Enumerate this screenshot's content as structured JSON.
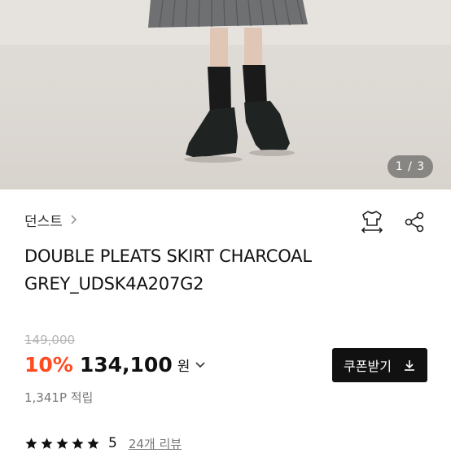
{
  "gallery": {
    "counter": "1 / 3"
  },
  "brand": {
    "name": "던스트"
  },
  "product": {
    "title_line1": "DOUBLE PLEATS SKIRT CHARCOAL",
    "title_line2": "GREY_UDSK4A207G2",
    "original_price": "149,000",
    "discount": "10%",
    "price": "134,100",
    "currency": "원",
    "points": "1,341P 적립"
  },
  "coupon": {
    "label": "쿠폰받기"
  },
  "rating": {
    "stars": 5,
    "score": "5",
    "reviews": "24개 리뷰"
  },
  "colors": {
    "discount": "#ff4b1f",
    "button_bg": "#111111",
    "muted": "#777777"
  }
}
